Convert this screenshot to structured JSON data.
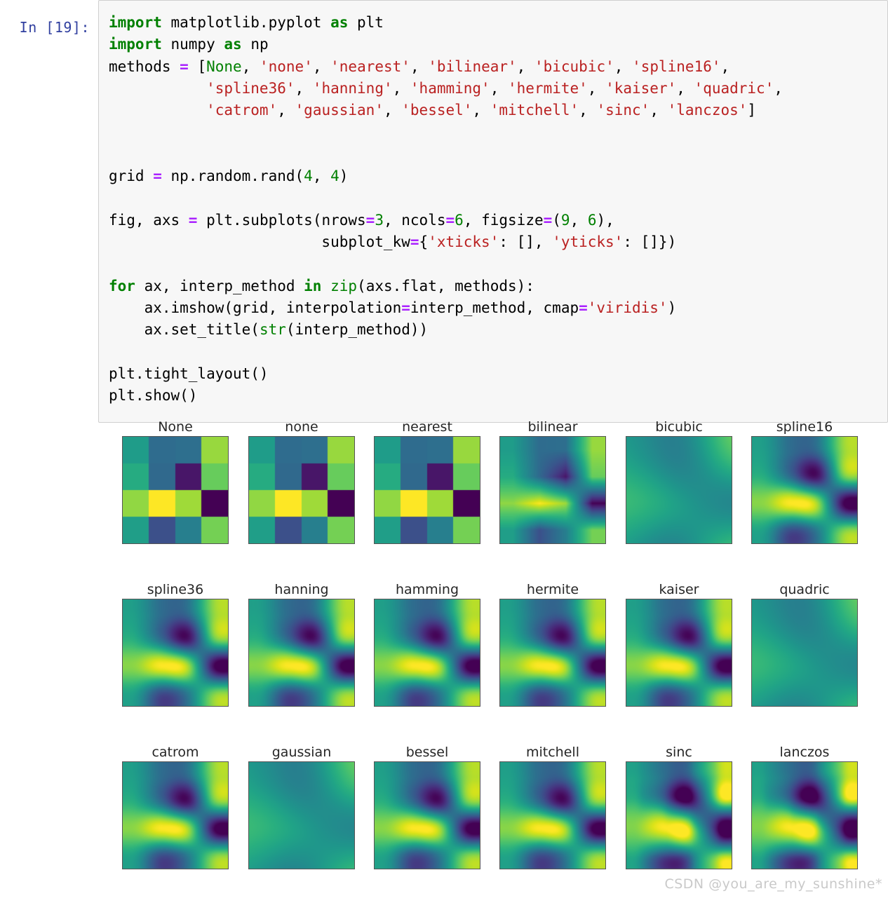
{
  "notebook": {
    "prompt_label": "In [19]:",
    "code_lines": [
      "import matplotlib.pyplot as plt",
      "import numpy as np",
      "methods = [None, 'none', 'nearest', 'bilinear', 'bicubic', 'spline16',",
      "           'spline36', 'hanning', 'hamming', 'hermite', 'kaiser', 'quadric',",
      "           'catrom', 'gaussian', 'bessel', 'mitchell', 'sinc', 'lanczos']",
      "",
      "",
      "grid = np.random.rand(4, 4)",
      "",
      "fig, axs = plt.subplots(nrows=3, ncols=6, figsize=(9, 6),",
      "                        subplot_kw={'xticks': [], 'yticks': []})",
      "",
      "for ax, interp_method in zip(axs.flat, methods):",
      "    ax.imshow(grid, interpolation=interp_method, cmap='viridis')",
      "    ax.set_title(str(interp_method))",
      "",
      "plt.tight_layout()",
      "plt.show()"
    ]
  },
  "watermark": {
    "text": "CSDN @you_are_my_sunshine*"
  },
  "chart_data": {
    "type": "heatmap",
    "title": "",
    "subplot_grid": {
      "nrows": 3,
      "ncols": 6,
      "figsize": [
        9,
        6
      ]
    },
    "colormap": "viridis",
    "xticks": [],
    "yticks": [],
    "grid_shape": [
      4,
      4
    ],
    "values": [
      [
        0.52,
        0.34,
        0.35,
        0.79
      ],
      [
        0.58,
        0.33,
        0.07,
        0.72
      ],
      [
        0.78,
        0.93,
        0.8,
        0.02
      ],
      [
        0.53,
        0.24,
        0.41,
        0.74
      ]
    ],
    "zlim": [
      0.02,
      0.93
    ],
    "panels": [
      {
        "title": "None",
        "interpolation": "none"
      },
      {
        "title": "none",
        "interpolation": "none"
      },
      {
        "title": "nearest",
        "interpolation": "none"
      },
      {
        "title": "bilinear",
        "interpolation": "bilinear"
      },
      {
        "title": "bicubic",
        "interpolation": "bicubic-soft"
      },
      {
        "title": "spline16",
        "interpolation": "spline"
      },
      {
        "title": "spline36",
        "interpolation": "spline"
      },
      {
        "title": "hanning",
        "interpolation": "spline"
      },
      {
        "title": "hamming",
        "interpolation": "spline"
      },
      {
        "title": "hermite",
        "interpolation": "spline"
      },
      {
        "title": "kaiser",
        "interpolation": "spline"
      },
      {
        "title": "quadric",
        "interpolation": "bicubic-soft"
      },
      {
        "title": "catrom",
        "interpolation": "spline"
      },
      {
        "title": "gaussian",
        "interpolation": "bicubic-soft"
      },
      {
        "title": "bessel",
        "interpolation": "spline"
      },
      {
        "title": "mitchell",
        "interpolation": "spline"
      },
      {
        "title": "sinc",
        "interpolation": "sharp"
      },
      {
        "title": "lanczos",
        "interpolation": "sharp"
      }
    ],
    "colormap_stops": [
      "#440154",
      "#481567",
      "#482677",
      "#453781",
      "#404788",
      "#39568c",
      "#33638d",
      "#2d708e",
      "#287d8e",
      "#238a8d",
      "#1f968b",
      "#20a387",
      "#29af7f",
      "#3cbb75",
      "#55c667",
      "#73d055",
      "#95d840",
      "#b8de29",
      "#dce319",
      "#fde725"
    ]
  }
}
